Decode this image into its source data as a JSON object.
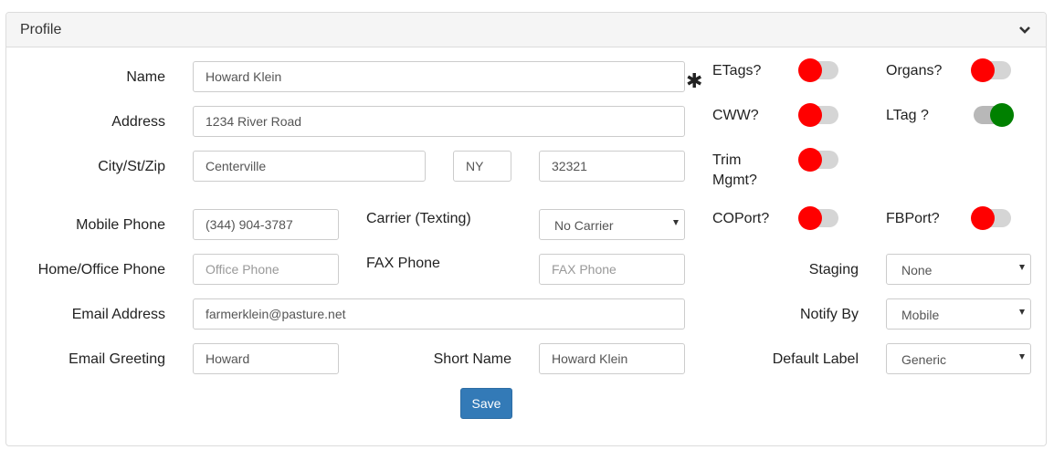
{
  "panel": {
    "title": "Profile"
  },
  "fields": {
    "name": {
      "label": "Name",
      "value": "Howard Klein"
    },
    "address": {
      "label": "Address",
      "value": "1234 River Road"
    },
    "city_st_zip": {
      "label": "City/St/Zip",
      "city": "Centerville",
      "state": "NY",
      "zip": "32321"
    },
    "mobile_phone": {
      "label": "Mobile Phone",
      "value": "(344) 904-3787"
    },
    "carrier": {
      "label": "Carrier (Texting)",
      "selected": "No Carrier"
    },
    "home_office_phone": {
      "label": "Home/Office Phone",
      "placeholder": "Office Phone"
    },
    "fax_phone": {
      "label": "FAX Phone",
      "placeholder": "FAX Phone"
    },
    "email_address": {
      "label": "Email Address",
      "value": "farmerklein@pasture.net"
    },
    "email_greeting": {
      "label": "Email Greeting",
      "value": "Howard"
    },
    "short_name": {
      "label": "Short Name",
      "value": "Howard Klein"
    }
  },
  "toggles": {
    "etags": {
      "label": "ETags?",
      "state": "off"
    },
    "organs": {
      "label": "Organs?",
      "state": "off"
    },
    "cww": {
      "label": "CWW?",
      "state": "off"
    },
    "ltag": {
      "label": "LTag ?",
      "state": "on"
    },
    "trim_mgmt": {
      "label_line1": "Trim",
      "label_line2": "Mgmt?",
      "state": "off"
    },
    "coport": {
      "label": "COPort?",
      "state": "off"
    },
    "fbport": {
      "label": "FBPort?",
      "state": "off"
    }
  },
  "selects": {
    "staging": {
      "label": "Staging",
      "selected": "None"
    },
    "notify_by": {
      "label": "Notify By",
      "selected": "Mobile"
    },
    "default_label": {
      "label": "Default Label",
      "selected": "Generic"
    }
  },
  "buttons": {
    "save": "Save"
  },
  "colors": {
    "toggle_off": "#ff0000",
    "toggle_on": "#008000",
    "primary": "#337ab7"
  },
  "icons": {
    "collapse": "chevron-down-icon",
    "required": "asterisk-icon"
  }
}
